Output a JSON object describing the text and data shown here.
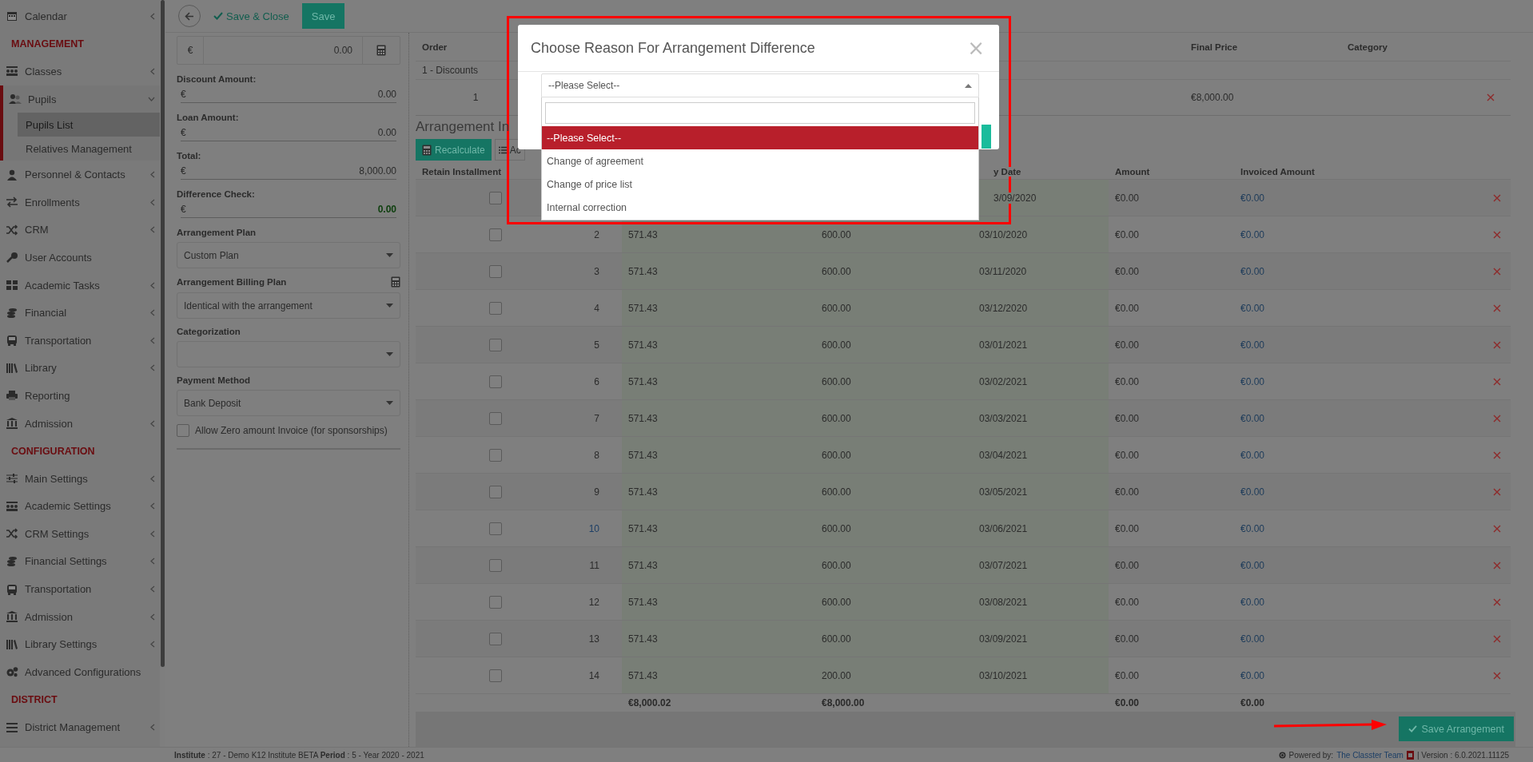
{
  "sidebar": {
    "items": [
      {
        "kind": "link",
        "label": "Calendar",
        "expandable": true,
        "expanded": false
      },
      {
        "kind": "heading",
        "label": "MANAGEMENT"
      },
      {
        "kind": "link",
        "label": "Classes",
        "expandable": true,
        "expanded": false
      },
      {
        "kind": "link",
        "label": "Pupils",
        "expandable": true,
        "expanded": true,
        "children": [
          {
            "label": "Pupils List",
            "selected": true
          },
          {
            "label": "Relatives Management",
            "selected": false
          }
        ]
      },
      {
        "kind": "link",
        "label": "Personnel & Contacts",
        "expandable": true,
        "expanded": false
      },
      {
        "kind": "link",
        "label": "Enrollments",
        "expandable": true,
        "expanded": false
      },
      {
        "kind": "link",
        "label": "CRM",
        "expandable": true,
        "expanded": false
      },
      {
        "kind": "link",
        "label": "User Accounts",
        "expandable": false,
        "expanded": false
      },
      {
        "kind": "link",
        "label": "Academic Tasks",
        "expandable": true,
        "expanded": false
      },
      {
        "kind": "link",
        "label": "Financial",
        "expandable": true,
        "expanded": false
      },
      {
        "kind": "link",
        "label": "Transportation",
        "expandable": true,
        "expanded": false
      },
      {
        "kind": "link",
        "label": "Library",
        "expandable": true,
        "expanded": false
      },
      {
        "kind": "link",
        "label": "Reporting",
        "expandable": false,
        "expanded": false
      },
      {
        "kind": "link",
        "label": "Admission",
        "expandable": true,
        "expanded": false
      },
      {
        "kind": "heading",
        "label": "CONFIGURATION"
      },
      {
        "kind": "link",
        "label": "Main Settings",
        "expandable": true,
        "expanded": false
      },
      {
        "kind": "link",
        "label": "Academic Settings",
        "expandable": true,
        "expanded": false
      },
      {
        "kind": "link",
        "label": "CRM Settings",
        "expandable": true,
        "expanded": false
      },
      {
        "kind": "link",
        "label": "Financial Settings",
        "expandable": true,
        "expanded": false
      },
      {
        "kind": "link",
        "label": "Transportation",
        "expandable": true,
        "expanded": false
      },
      {
        "kind": "link",
        "label": "Admission",
        "expandable": true,
        "expanded": false
      },
      {
        "kind": "link",
        "label": "Library Settings",
        "expandable": true,
        "expanded": false
      },
      {
        "kind": "link",
        "label": "Advanced Configurations",
        "expandable": false,
        "expanded": false
      },
      {
        "kind": "heading",
        "label": "DISTRICT"
      },
      {
        "kind": "link",
        "label": "District Management",
        "expandable": true,
        "expanded": false
      }
    ]
  },
  "toolbar": {
    "save_close": "Save & Close",
    "save": "Save"
  },
  "form": {
    "top_field": {
      "currency": "€",
      "value": "0.00"
    },
    "amounts": [
      {
        "label": "Discount Amount:",
        "currency": "€",
        "value": "0.00",
        "positive": false
      },
      {
        "label": "Loan Amount:",
        "currency": "€",
        "value": "0.00",
        "positive": false
      },
      {
        "label": "Total:",
        "currency": "€",
        "value": "8,000.00",
        "positive": false
      },
      {
        "label": "Difference Check:",
        "currency": "€",
        "value": "0.00",
        "positive": true
      }
    ],
    "selects": [
      {
        "label": "Arrangement Plan",
        "value": "Custom Plan",
        "calculator": false
      },
      {
        "label": "Arrangement Billing Plan",
        "value": "Identical with the arrangement",
        "calculator": true
      },
      {
        "label": "Categorization",
        "calculator": false
      },
      {
        "label": "Payment Method",
        "value": "Bank Deposit",
        "calculator": false
      }
    ],
    "checkbox": {
      "label": "Allow Zero amount Invoice (for sponsorships)",
      "checked": false
    }
  },
  "items_table": {
    "columns": [
      "Order",
      "Final Price",
      "Category"
    ],
    "group": "1 - Discounts",
    "rows": [
      {
        "order": "1",
        "final_price": "€8,000.00"
      }
    ]
  },
  "installments": {
    "heading": "Arrangement In",
    "recalculate": "Recalculate",
    "actions": "Ac",
    "columns": [
      "Retain Installment",
      "y Date",
      "Amount",
      "Invoiced Amount"
    ],
    "rows": [
      {
        "retain": false,
        "date": "3/09/2020",
        "amount": "€0.00",
        "invoiced": "€0.00"
      },
      {
        "retain": false,
        "order": "2",
        "column_3": "571.43",
        "column_4": "600.00",
        "date": "03/10/2020",
        "amount": "€0.00",
        "invoiced": "€0.00",
        "link": false
      },
      {
        "retain": false,
        "order": "3",
        "column_3": "571.43",
        "column_4": "600.00",
        "date": "03/11/2020",
        "amount": "€0.00",
        "invoiced": "€0.00",
        "link": false
      },
      {
        "retain": false,
        "order": "4",
        "column_3": "571.43",
        "column_4": "600.00",
        "date": "03/12/2020",
        "amount": "€0.00",
        "invoiced": "€0.00",
        "link": false
      },
      {
        "retain": false,
        "order": "5",
        "column_3": "571.43",
        "column_4": "600.00",
        "date": "03/01/2021",
        "amount": "€0.00",
        "invoiced": "€0.00",
        "link": false
      },
      {
        "retain": false,
        "order": "6",
        "column_3": "571.43",
        "column_4": "600.00",
        "date": "03/02/2021",
        "amount": "€0.00",
        "invoiced": "€0.00",
        "link": false
      },
      {
        "retain": false,
        "order": "7",
        "column_3": "571.43",
        "column_4": "600.00",
        "date": "03/03/2021",
        "amount": "€0.00",
        "invoiced": "€0.00",
        "link": false
      },
      {
        "retain": false,
        "order": "8",
        "column_3": "571.43",
        "column_4": "600.00",
        "date": "03/04/2021",
        "amount": "€0.00",
        "invoiced": "€0.00",
        "link": false
      },
      {
        "retain": false,
        "order": "9",
        "column_3": "571.43",
        "column_4": "600.00",
        "date": "03/05/2021",
        "amount": "€0.00",
        "invoiced": "€0.00",
        "link": false
      },
      {
        "retain": false,
        "order": "10",
        "column_3": "571.43",
        "column_4": "600.00",
        "date": "03/06/2021",
        "amount": "€0.00",
        "invoiced": "€0.00",
        "link": true
      },
      {
        "retain": false,
        "order": "11",
        "column_3": "571.43",
        "column_4": "600.00",
        "date": "03/07/2021",
        "amount": "€0.00",
        "invoiced": "€0.00",
        "link": false
      },
      {
        "retain": false,
        "order": "12",
        "column_3": "571.43",
        "column_4": "600.00",
        "date": "03/08/2021",
        "amount": "€0.00",
        "invoiced": "€0.00",
        "link": false
      },
      {
        "retain": false,
        "order": "13",
        "column_3": "571.43",
        "column_4": "600.00",
        "date": "03/09/2021",
        "amount": "€0.00",
        "invoiced": "€0.00",
        "link": false
      },
      {
        "retain": false,
        "order": "14",
        "column_3": "571.43",
        "column_4": "200.00",
        "date": "03/10/2021",
        "amount": "€0.00",
        "invoiced": "€0.00",
        "link": false
      }
    ],
    "totals": {
      "column_3": "€8,000.02",
      "column_4": "€8,000.00",
      "amount": "€0.00",
      "invoiced": "€0.00"
    },
    "save": "Save Arrangement"
  },
  "footer": {
    "info": "**Institute** : 27 - Demo K12 Institute BETA **Period** : 5 - Year 2020 - 2021",
    "powered_by": "Powered by:",
    "team": "The Classter Team",
    "version": "| Version : 6.0.2021.11125"
  },
  "modal": {
    "title": "Choose Reason For Arrangement Difference",
    "close": "×",
    "select_value": "--Please Select--",
    "options": [
      {
        "label": "--Please Select--",
        "selected": true
      },
      {
        "label": "Change of agreement",
        "selected": false
      },
      {
        "label": "Change of price list",
        "selected": false
      },
      {
        "label": "Internal correction",
        "selected": false
      }
    ]
  }
}
